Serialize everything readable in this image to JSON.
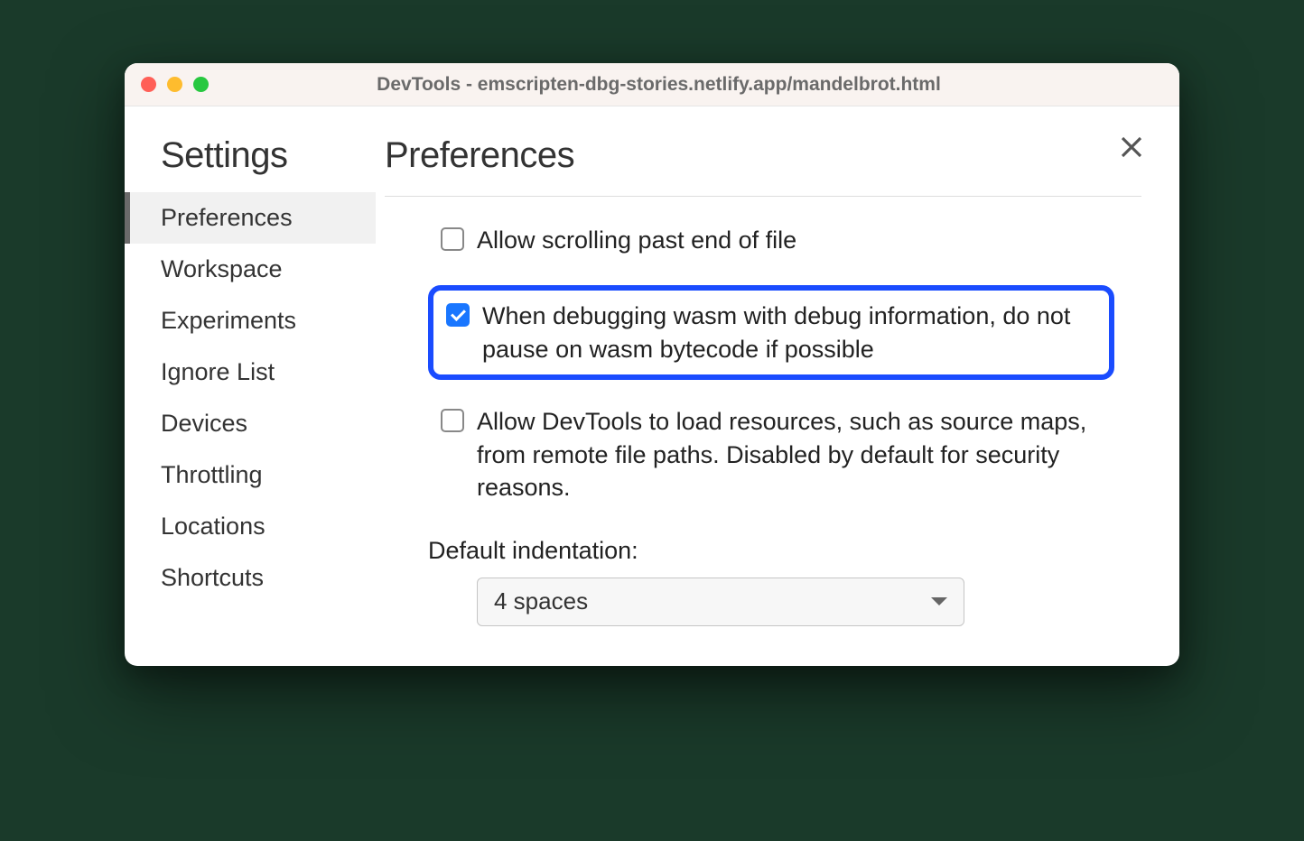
{
  "window": {
    "title": "DevTools - emscripten-dbg-stories.netlify.app/mandelbrot.html"
  },
  "sidebar": {
    "title": "Settings",
    "items": [
      {
        "label": "Preferences",
        "active": true
      },
      {
        "label": "Workspace",
        "active": false
      },
      {
        "label": "Experiments",
        "active": false
      },
      {
        "label": "Ignore List",
        "active": false
      },
      {
        "label": "Devices",
        "active": false
      },
      {
        "label": "Throttling",
        "active": false
      },
      {
        "label": "Locations",
        "active": false
      },
      {
        "label": "Shortcuts",
        "active": false
      }
    ]
  },
  "main": {
    "title": "Preferences",
    "options": [
      {
        "label": "Allow scrolling past end of file",
        "checked": false,
        "highlighted": false
      },
      {
        "label": "When debugging wasm with debug information, do not pause on wasm bytecode if possible",
        "checked": true,
        "highlighted": true
      },
      {
        "label": "Allow DevTools to load resources, such as source maps, from remote file paths. Disabled by default for security reasons.",
        "checked": false,
        "highlighted": false
      }
    ],
    "indentation": {
      "label": "Default indentation:",
      "value": "4 spaces"
    }
  }
}
